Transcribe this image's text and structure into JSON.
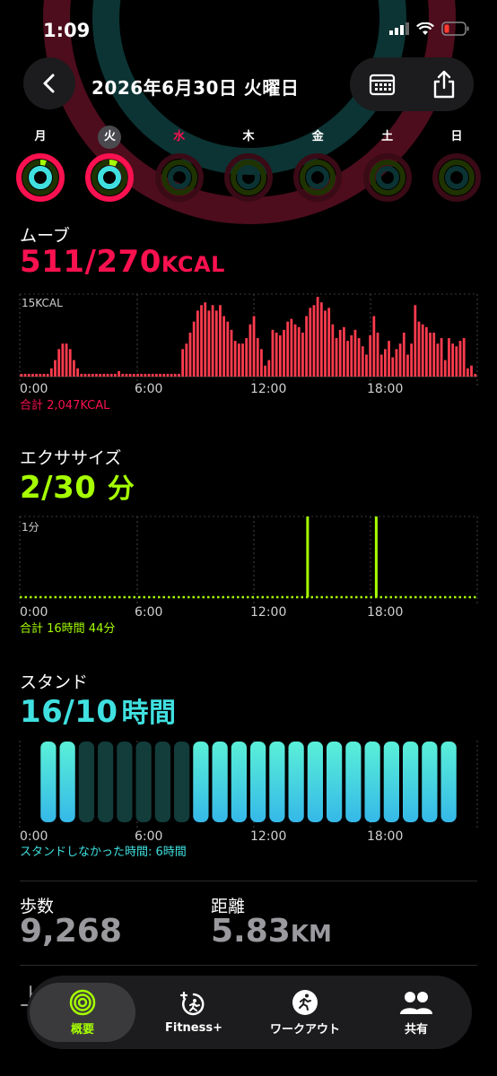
{
  "status": {
    "time": "1:09"
  },
  "header": {
    "date_title": "2026年6月30日 火曜日"
  },
  "colors": {
    "move": "#fa114f",
    "move_bar": "#ff3b4e",
    "exercise": "#a6ff00",
    "stand": "#40e0e0"
  },
  "week": [
    {
      "label": "月",
      "selected": false,
      "today": false
    },
    {
      "label": "火",
      "selected": true,
      "today": false
    },
    {
      "label": "水",
      "selected": false,
      "today": true
    },
    {
      "label": "木",
      "selected": false,
      "today": false
    },
    {
      "label": "金",
      "selected": false,
      "today": false
    },
    {
      "label": "土",
      "selected": false,
      "today": false
    },
    {
      "label": "日",
      "selected": false,
      "today": false
    }
  ],
  "time_axis": [
    "0:00",
    "6:00",
    "12:00",
    "18:00"
  ],
  "move": {
    "title": "ムーブ",
    "value": "511/270",
    "unit": "KCAL",
    "scale_label": "15KCAL",
    "total": "合計 2,047KCAL",
    "bars": [
      0.5,
      0.5,
      0.5,
      0.5,
      0.5,
      0.5,
      0.5,
      0.5,
      1.5,
      3,
      5,
      6,
      6,
      5,
      3,
      1.5,
      0.5,
      0.5,
      0.5,
      0.5,
      0.5,
      0.5,
      0.5,
      0.5,
      0.5,
      0.5,
      1,
      0.5,
      0.5,
      0.5,
      0.5,
      0.5,
      0.5,
      0.5,
      0.5,
      0.5,
      0.5,
      0.5,
      0.5,
      0.5,
      0.5,
      0.5,
      0.5,
      5,
      6,
      8,
      10,
      12,
      13,
      13.5,
      12,
      13,
      12,
      13,
      11,
      10,
      8.5,
      6.5,
      6,
      6,
      7,
      9.5,
      11,
      7,
      5,
      2,
      3,
      8.5,
      8,
      7.5,
      8.5,
      10,
      10.5,
      9.5,
      9,
      8,
      11,
      12.5,
      13,
      14.5,
      13.5,
      12,
      12.5,
      9.5,
      7,
      8.5,
      9,
      6.5,
      7.5,
      8.5,
      7,
      5.5,
      4,
      7.5,
      11,
      8,
      4,
      5,
      6.5,
      3.5,
      5,
      6,
      8,
      4,
      6,
      13,
      10,
      9.5,
      9,
      8,
      8,
      6,
      7,
      3,
      7,
      6,
      5.5,
      6.5,
      7,
      1.5,
      2,
      0.5
    ]
  },
  "exercise": {
    "title": "エクササイズ",
    "value": "2/30",
    "unit": "分",
    "scale_label": "1分",
    "total": "合計 16時間 44分",
    "spikes_hour": [
      15.1,
      18.7
    ]
  },
  "stand": {
    "title": "スタンド",
    "value": "16/10",
    "unit": "時間",
    "footer": "スタンドしなかった時間: 6時間",
    "hours": [
      1,
      1,
      0,
      0,
      0,
      0,
      0,
      0,
      1,
      1,
      1,
      1,
      1,
      1,
      1,
      1,
      1,
      1,
      1,
      1,
      1,
      1
    ]
  },
  "stats": {
    "steps": {
      "label": "歩数",
      "value": "9,268"
    },
    "distance": {
      "label": "距離",
      "value": "5.83",
      "unit": "KM"
    },
    "cut_label": "上"
  },
  "tabs": [
    {
      "label": "概要",
      "icon": "summary-rings-icon",
      "active": true
    },
    {
      "label": "Fitness+",
      "icon": "fitness-plus-icon",
      "active": false
    },
    {
      "label": "ワークアウト",
      "icon": "workout-runner-icon",
      "active": false
    },
    {
      "label": "共有",
      "icon": "sharing-people-icon",
      "active": false
    }
  ]
}
